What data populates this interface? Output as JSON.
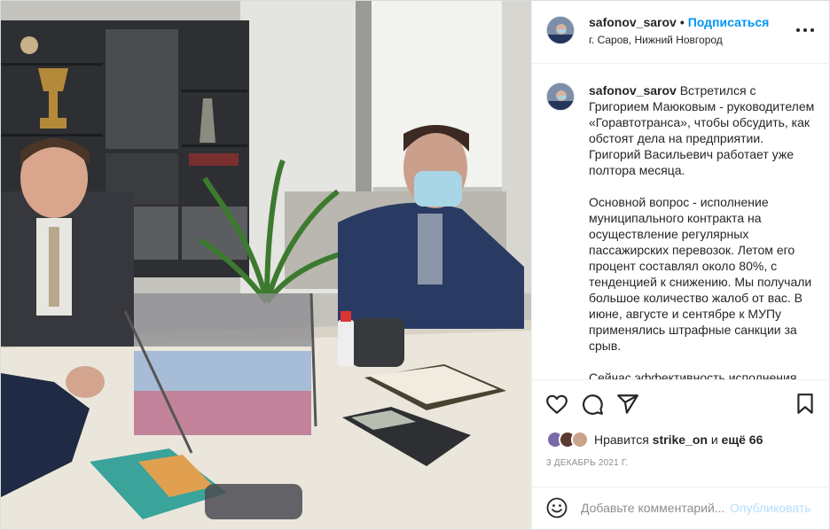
{
  "header": {
    "username": "safonov_sarov",
    "separator": "•",
    "follow_label": "Подписаться",
    "location": "г. Саров, Нижний Новгород"
  },
  "caption": {
    "username": "safonov_sarov",
    "paragraphs": [
      "Встретился с Григорием Маюковым - руководителем «Горавтотранса», чтобы обсудить, как обстоят дела на предприятии. Григорий Васильевич работает уже полтора месяца.",
      "Основной вопрос - исполнение муниципального контракта на осуществление регулярных пассажирских перевозок. Летом его процент составлял около 80%, с тенденцией к снижению. Мы получали большое количество жалоб от вас. В июне, августе и сентябре к МУПу применялись штрафные санкции за срыв.",
      "Сейчас эффективность исполнения"
    ]
  },
  "likes": {
    "prefix": "Нравится",
    "user": "strike_on",
    "middle": "и",
    "others": "ещё 66"
  },
  "date": "3 ДЕКАБРЬ 2021 Г.",
  "comment": {
    "placeholder": "Добавьте комментарий...",
    "publish_label": "Опубликовать"
  },
  "icons": [
    "like-icon",
    "comment-icon",
    "share-icon",
    "save-icon",
    "more-icon",
    "emoji-icon"
  ],
  "colors": {
    "accent": "#0095f6",
    "publish_disabled": "#b2dffc",
    "muted": "#8e8e8e",
    "text": "#262626"
  }
}
